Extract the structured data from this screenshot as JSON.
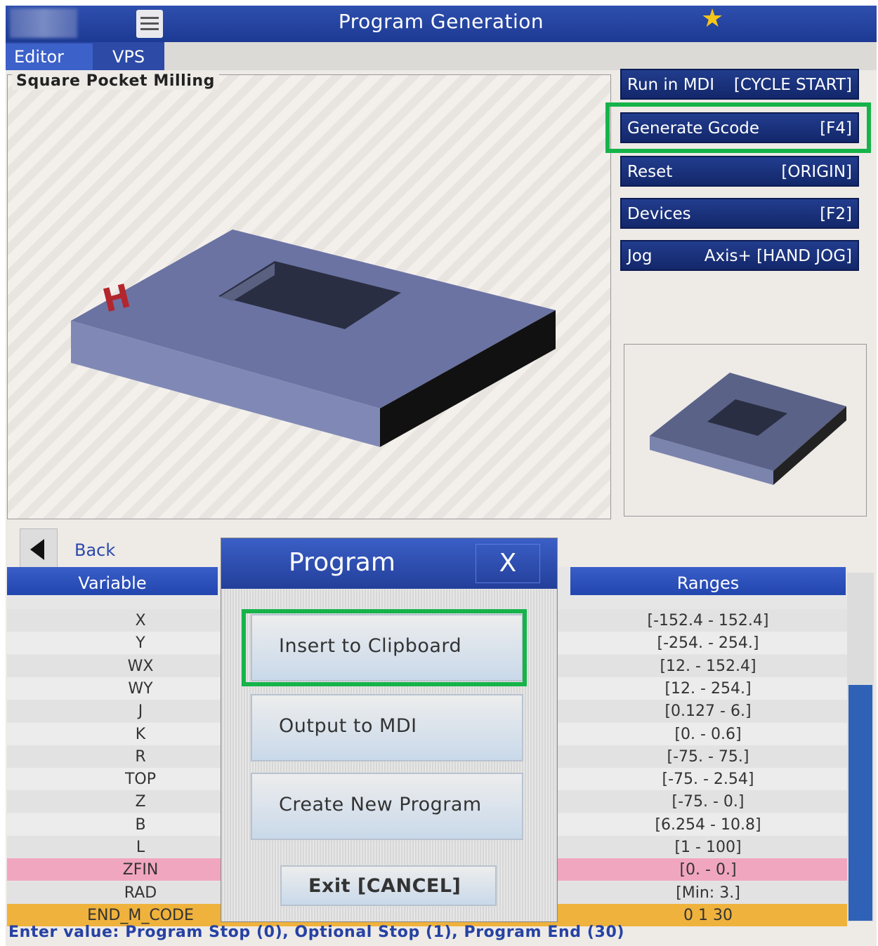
{
  "header": {
    "title": "Program Generation"
  },
  "tabs": [
    {
      "label": "Editor"
    },
    {
      "label": "VPS"
    }
  ],
  "panel": {
    "title": "Square Pocket Milling"
  },
  "side_buttons": [
    {
      "label": "Run in MDI",
      "shortcut": "[CYCLE START]"
    },
    {
      "label": "Generate Gcode",
      "shortcut": "[F4]"
    },
    {
      "label": "Reset",
      "shortcut": "[ORIGIN]"
    },
    {
      "label": "Devices",
      "shortcut": "[F2]"
    },
    {
      "label": "Jog",
      "shortcut": "Axis+ [HAND JOG]"
    }
  ],
  "back": {
    "label": "Back"
  },
  "table": {
    "headers": {
      "variable": "Variable",
      "ranges": "Ranges"
    },
    "rows": [
      {
        "variable": "X",
        "range": "[-152.4 - 152.4]"
      },
      {
        "variable": "Y",
        "range": "[-254. - 254.]"
      },
      {
        "variable": "WX",
        "range": "[12. - 152.4]"
      },
      {
        "variable": "WY",
        "range": "[12. - 254.]"
      },
      {
        "variable": "J",
        "range": "[0.127 - 6.]"
      },
      {
        "variable": "K",
        "range": "[0. - 0.6]"
      },
      {
        "variable": "R",
        "range": "[-75. - 75.]"
      },
      {
        "variable": "TOP",
        "range": "[-75. - 2.54]"
      },
      {
        "variable": "Z",
        "range": "[-75. - 0.]"
      },
      {
        "variable": "B",
        "range": "[6.254 - 10.8]"
      },
      {
        "variable": "L",
        "range": "[1 - 100]"
      },
      {
        "variable": "ZFIN",
        "range": "[0. - 0.]"
      },
      {
        "variable": "RAD",
        "range": "[Min: 3.]"
      },
      {
        "variable": "END_M_CODE",
        "range": "0 1 30"
      }
    ]
  },
  "status": "Enter value: Program Stop (0), Optional Stop (1), Program End (30)",
  "dialog": {
    "title": "Program",
    "close": "X",
    "buttons": [
      "Insert to Clipboard",
      "Output to MDI",
      "Create New Program"
    ],
    "exit": "Exit [CANCEL]"
  },
  "colors": {
    "title_bar": "#2f4fae",
    "highlight": "#16b34a",
    "zfin_row": "#f1a6c0",
    "end_m_code_row": "#efb23c"
  }
}
